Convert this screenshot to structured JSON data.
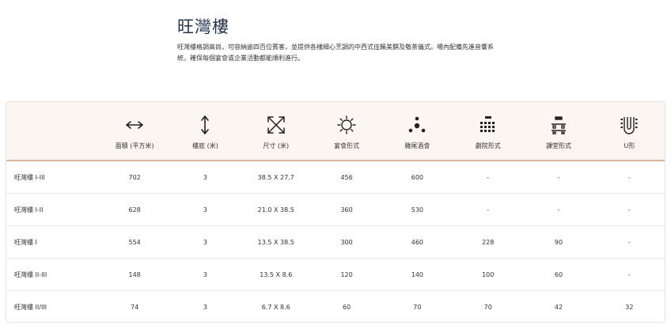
{
  "title": "旺灣樓",
  "description": "旺灣樓格調高尚，可容納逾四百位賓客，並提供各樣細心烹調的中西式佳餚美饌及敬茶儀式。場內配備先進音響系統，確保每個宴會或企業活動都能順利進行。",
  "columns": [
    {
      "label": "面積 (平方米)",
      "icon": "horizontal-arrows-icon"
    },
    {
      "label": "樓底 (米)",
      "icon": "vertical-arrows-icon"
    },
    {
      "label": "尺寸 (米)",
      "icon": "expand-diagonal-icon"
    },
    {
      "label": "宴會形式",
      "icon": "banquet-round-table-icon"
    },
    {
      "label": "雞尾酒會",
      "icon": "cocktail-icon"
    },
    {
      "label": "劇院形式",
      "icon": "theatre-icon"
    },
    {
      "label": "課堂形式",
      "icon": "classroom-icon"
    },
    {
      "label": "U形",
      "icon": "u-shape-icon"
    }
  ],
  "rows": [
    {
      "name": "旺灣樓 I-III",
      "cells": [
        "702",
        "3",
        "38.5 X 27.7",
        "456",
        "600",
        "-",
        "-",
        "-"
      ]
    },
    {
      "name": "旺灣樓 I-II",
      "cells": [
        "628",
        "3",
        "21.0 X 38.5",
        "360",
        "530",
        "-",
        "-",
        "-"
      ]
    },
    {
      "name": "旺灣樓 I",
      "cells": [
        "554",
        "3",
        "13.5 X 38.5",
        "300",
        "460",
        "228",
        "90",
        "-"
      ]
    },
    {
      "name": "旺灣樓 II-III",
      "cells": [
        "148",
        "3",
        "13.5 X 8.6",
        "120",
        "140",
        "100",
        "60",
        "-"
      ]
    },
    {
      "name": "旺灣樓 II/III",
      "cells": [
        "74",
        "3",
        "6.7 X 8.6",
        "60",
        "70",
        "70",
        "42",
        "32"
      ]
    }
  ]
}
